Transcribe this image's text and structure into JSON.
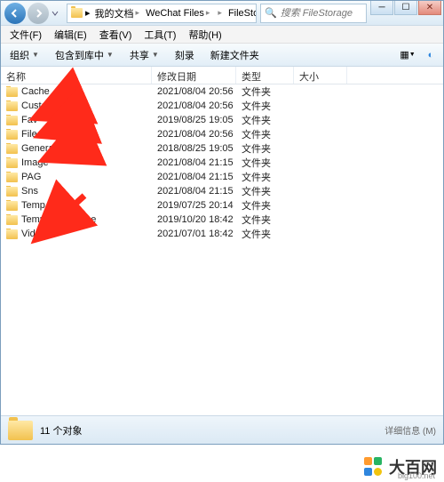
{
  "breadcrumbs": [
    "我的文档",
    "WeChat Files",
    "",
    "FileStorage"
  ],
  "search_placeholder": "搜索 FileStorage",
  "menu": {
    "file": "文件(F)",
    "edit": "编辑(E)",
    "view": "查看(V)",
    "tools": "工具(T)",
    "help": "帮助(H)"
  },
  "toolbar": {
    "organize": "组织",
    "include": "包含到库中",
    "share": "共享",
    "burn": "刻录",
    "new_folder": "新建文件夹"
  },
  "columns": {
    "name": "名称",
    "date": "修改日期",
    "type": "类型",
    "size": "大小"
  },
  "rows": [
    {
      "name": "Cache",
      "date": "2021/08/04 20:56",
      "type": "文件夹"
    },
    {
      "name": "CustomEmoji",
      "date": "2021/08/04 20:56",
      "type": "文件夹"
    },
    {
      "name": "Fav",
      "date": "2019/08/25 19:05",
      "type": "文件夹"
    },
    {
      "name": "File",
      "date": "2021/08/04 20:56",
      "type": "文件夹"
    },
    {
      "name": "General",
      "date": "2018/08/25 19:05",
      "type": "文件夹"
    },
    {
      "name": "Image",
      "date": "2021/08/04 21:15",
      "type": "文件夹"
    },
    {
      "name": "PAG",
      "date": "2021/08/04 21:15",
      "type": "文件夹"
    },
    {
      "name": "Sns",
      "date": "2021/08/04 21:15",
      "type": "文件夹"
    },
    {
      "name": "Temp",
      "date": "2019/07/25 20:14",
      "type": "文件夹"
    },
    {
      "name": "TempFromPhone",
      "date": "2019/10/20 18:42",
      "type": "文件夹"
    },
    {
      "name": "Video",
      "date": "2021/07/01 18:42",
      "type": "文件夹"
    }
  ],
  "status": {
    "count": "11 个对象",
    "details": "详细信息 (M)"
  },
  "watermark": {
    "brand": "大百网",
    "url": "big100.net"
  },
  "colors": {
    "logo": [
      "#ff9b2f",
      "#28b463",
      "#2e86de",
      "#f1c40f"
    ]
  }
}
